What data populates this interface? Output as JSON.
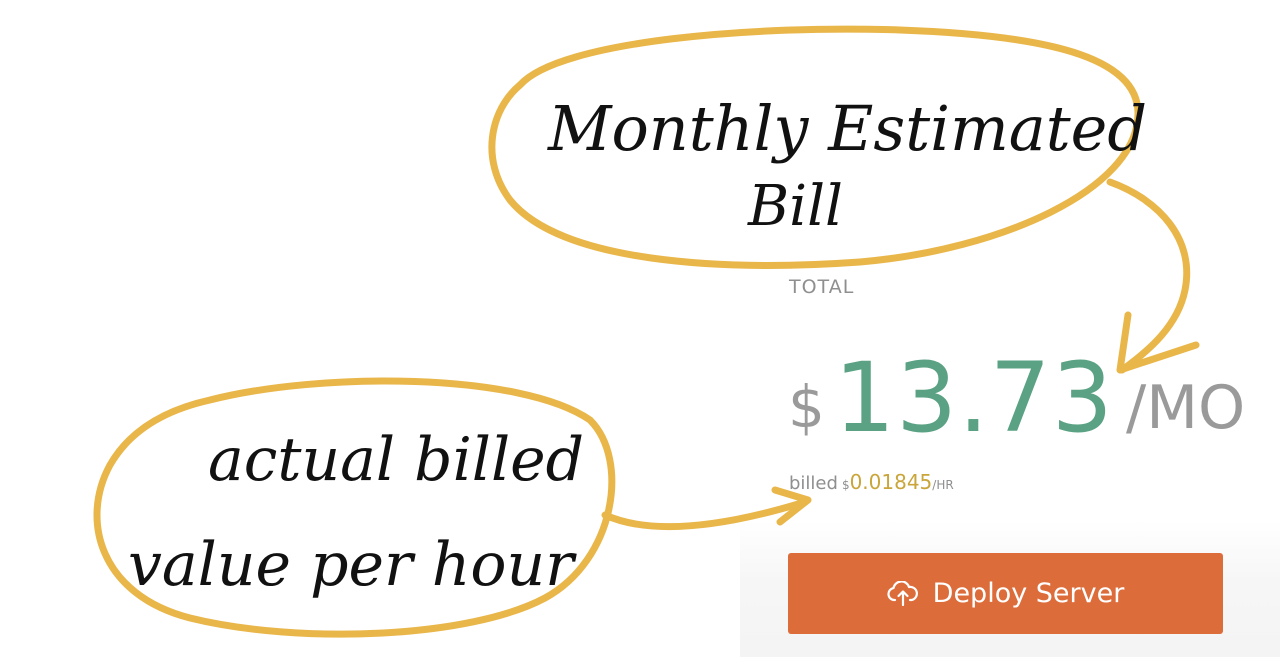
{
  "pricing": {
    "total_label": "TOTAL",
    "currency_symbol": "$",
    "monthly_amount": "13.73",
    "monthly_unit": "/MO",
    "billed_prefix": "billed",
    "hourly_currency": "$",
    "hourly_amount": "0.01845",
    "hourly_unit": "/HR"
  },
  "deploy_button": {
    "label": "Deploy Server",
    "icon": "cloud-upload-icon"
  },
  "annotations": {
    "monthly_note": "Monthly Estimated Bill",
    "hourly_note": "actual billed value per hour",
    "stroke_color": "#e9b64a",
    "ink_color": "#111111"
  },
  "colors": {
    "amount_green": "#5aa283",
    "hourly_gold": "#c9a53a",
    "muted_gray": "#9a9a9a",
    "button_orange": "#dd6c3b"
  }
}
